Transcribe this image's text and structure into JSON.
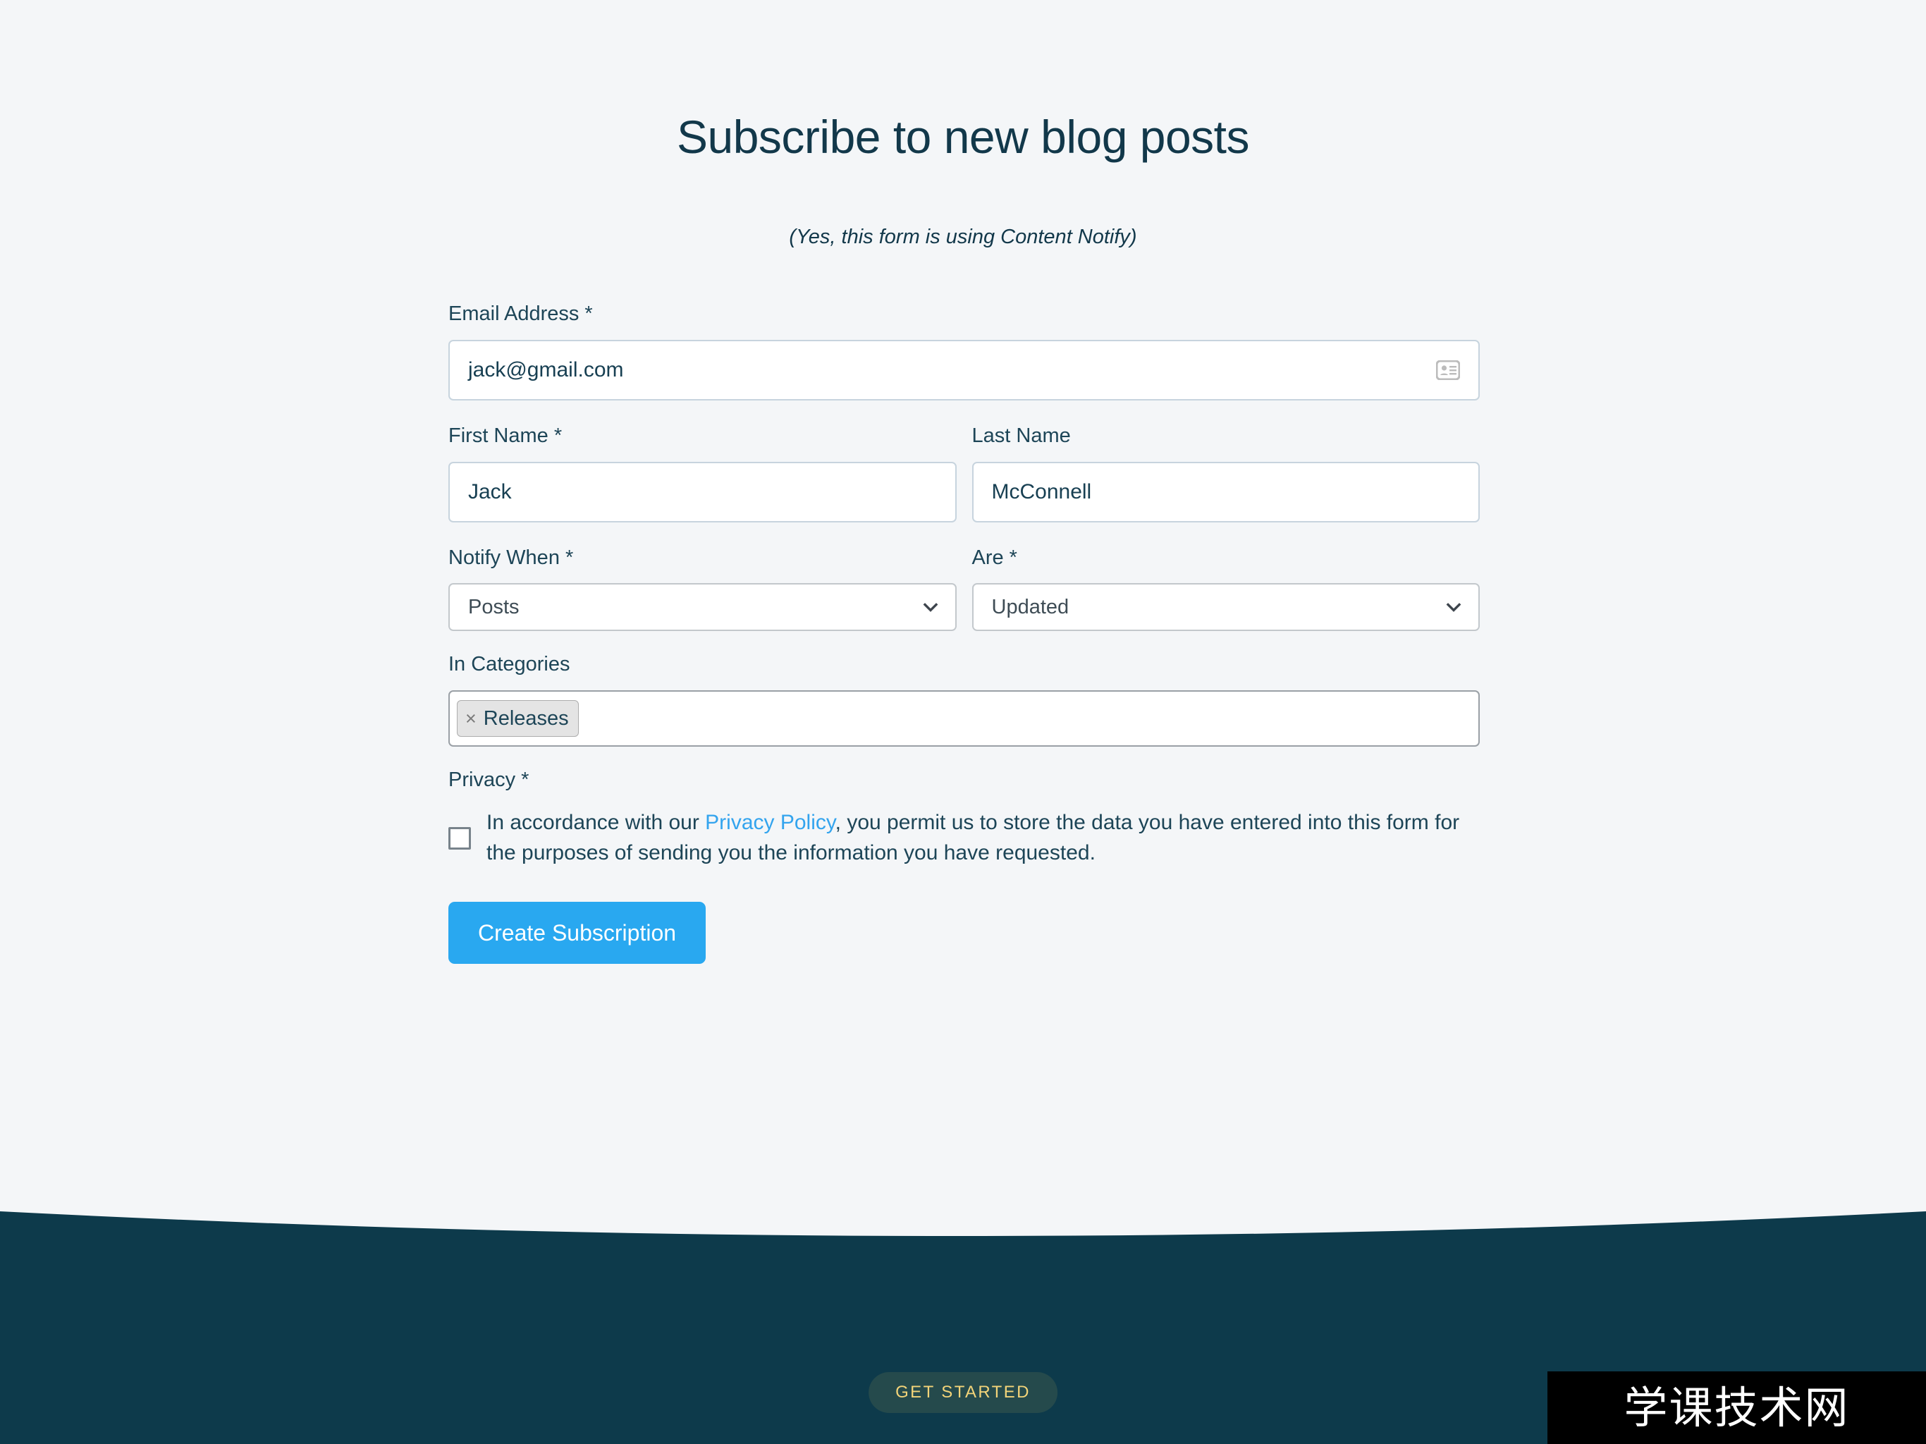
{
  "page": {
    "title": "Subscribe to new blog posts",
    "subtitle": "(Yes, this form is using Content Notify)",
    "background_color": "#f4f6f8",
    "heading_color": "#12384a"
  },
  "form": {
    "email": {
      "label": "Email Address *",
      "value": "jack@gmail.com",
      "placeholder": "",
      "autofill_icon": "contact-card-icon"
    },
    "first_name": {
      "label": "First Name *",
      "value": "Jack",
      "placeholder": ""
    },
    "last_name": {
      "label": "Last Name",
      "value": "McConnell",
      "placeholder": ""
    },
    "notify_when": {
      "label": "Notify When *",
      "value": "Posts",
      "icon": "chevron-down-icon"
    },
    "are": {
      "label": "Are *",
      "value": "Updated",
      "icon": "chevron-down-icon"
    },
    "in_categories": {
      "label": "In Categories",
      "tokens": [
        {
          "remove_glyph": "×",
          "label": "Releases"
        }
      ]
    },
    "privacy": {
      "label": "Privacy *",
      "checked": false,
      "text_before_link": "In accordance with our ",
      "link_text": "Privacy Policy",
      "text_after_link": ", you permit us to store the data you have entered into this form for the purposes of sending you the information you have requested.",
      "link_color": "#33a4ee"
    },
    "submit": {
      "label": "Create Subscription",
      "color": "#29a8f0"
    }
  },
  "footer": {
    "background_color": "#0d3a4b",
    "cta_label": "GET STARTED",
    "cta_background": "#254a4c",
    "cta_text_color": "#f3d479"
  },
  "watermark": {
    "text": "学课技术网",
    "background_color": "#000000",
    "text_color": "#ffffff"
  }
}
